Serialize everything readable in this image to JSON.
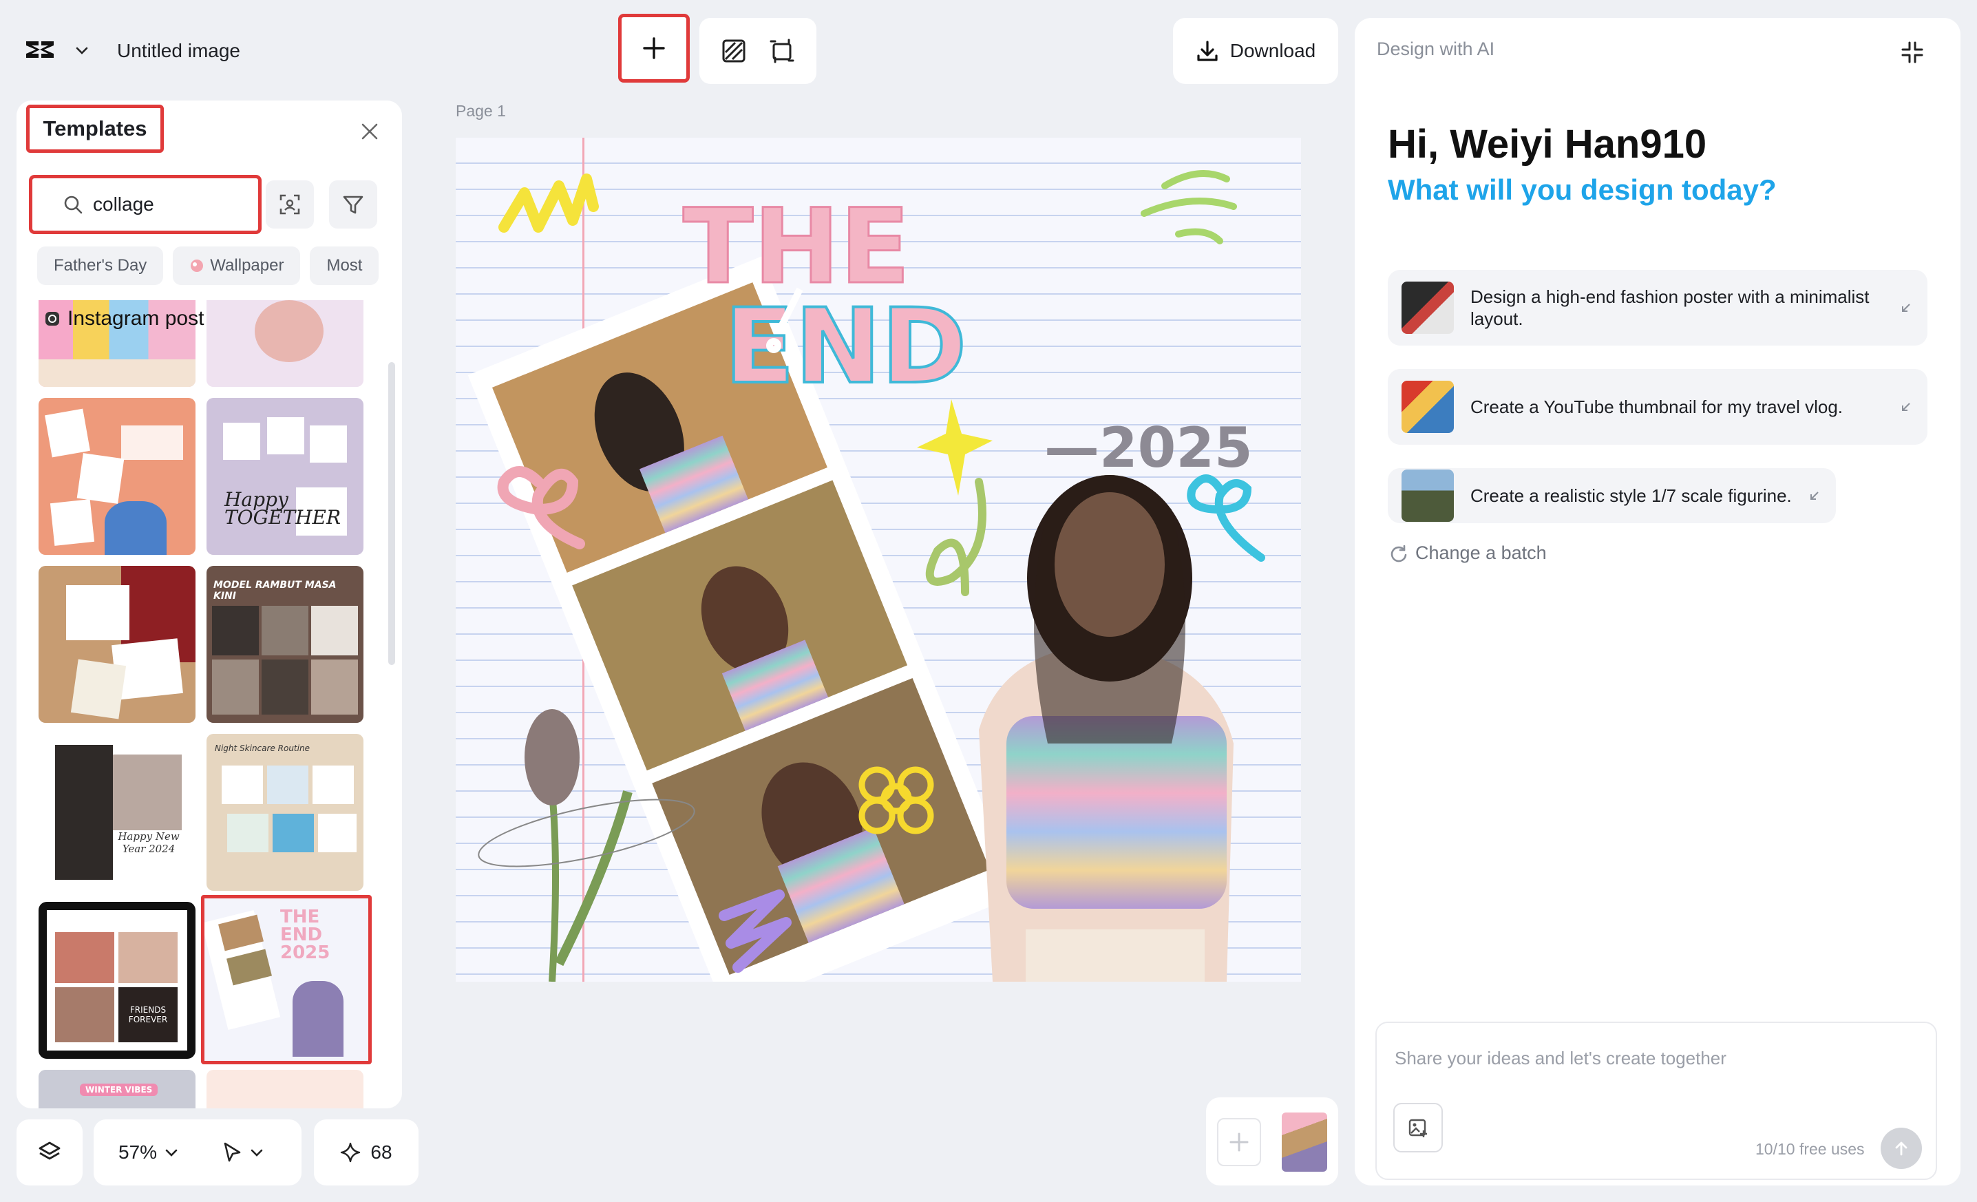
{
  "app": {
    "title": "Untitled image"
  },
  "toolbar": {
    "add_label": "+",
    "download_label": "Download"
  },
  "templates_panel": {
    "title": "Templates",
    "search": {
      "value": "collage"
    },
    "chips": [
      {
        "label": "Father's Day"
      },
      {
        "label": "Wallpaper"
      },
      {
        "label": "Most"
      }
    ],
    "instagram_label": "Instagram post",
    "thumbnails": [
      {
        "text": "Happy TOGETHER"
      },
      {
        "text": "MODEL RAMBUT MASA KINI"
      },
      {
        "text": "Happy New Year 2024"
      },
      {
        "text": "Night Skincare Routine"
      },
      {
        "text": "FRIENDS FOREVER"
      },
      {
        "text": "THE END 2025"
      },
      {
        "text": "WINTER VIBES"
      }
    ]
  },
  "bottom_controls": {
    "zoom": "57%",
    "credits": "68"
  },
  "canvas": {
    "page_label": "Page 1",
    "headline_1": "THE",
    "headline_2": "END",
    "year": "—2025"
  },
  "ai_panel": {
    "header": "Design with AI",
    "greeting": "Hi, Weiyi Han910",
    "question": "What will you design today?",
    "suggestions": [
      {
        "text": "Design a high-end fashion poster with a minimalist layout."
      },
      {
        "text": "Create a YouTube thumbnail for my travel vlog."
      },
      {
        "text": "Create a realistic style 1/7 scale figurine."
      }
    ],
    "change_batch": "Change a batch",
    "composer": {
      "placeholder": "Share your ideas and let's create together",
      "uses": "10/10 free uses"
    }
  },
  "colors": {
    "highlight": "#e03a3a",
    "accent_blue": "#1ea4e9",
    "background": "#eef0f4"
  }
}
